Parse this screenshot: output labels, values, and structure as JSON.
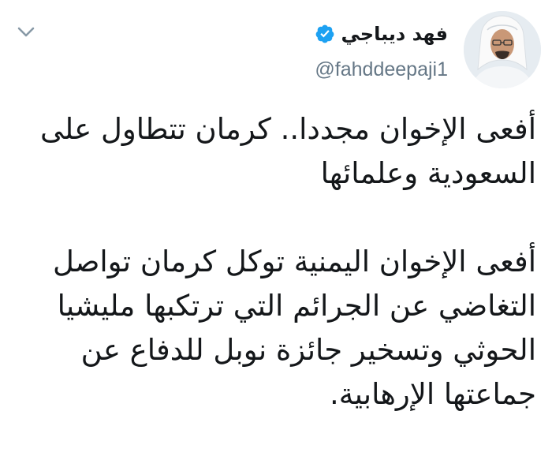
{
  "tweet": {
    "author": {
      "name": "فهد ديباجي",
      "handle": "@fahddeepaji1",
      "verified": true
    },
    "paragraphs": [
      {
        "lines": [
          "أفعى الإخوان مجددا.. كرمان تتطاول على",
          "السعودية وعلمائها"
        ]
      },
      {
        "lines": [
          "أفعى الإخوان اليمنية توكل كرمان تواصل",
          "التغاضي عن الجرائم التي ترتكبها مليشيا",
          "الحوثي وتسخير جائزة نوبل للدفاع عن",
          "جماعتها الإرهابية."
        ]
      }
    ]
  },
  "icons": {
    "menu": "chevron-down-icon",
    "verified": "verified-badge-icon"
  },
  "colors": {
    "text": "#14171a",
    "secondary": "#657786",
    "verified": "#1da1f2",
    "chevron": "#8899a6"
  }
}
